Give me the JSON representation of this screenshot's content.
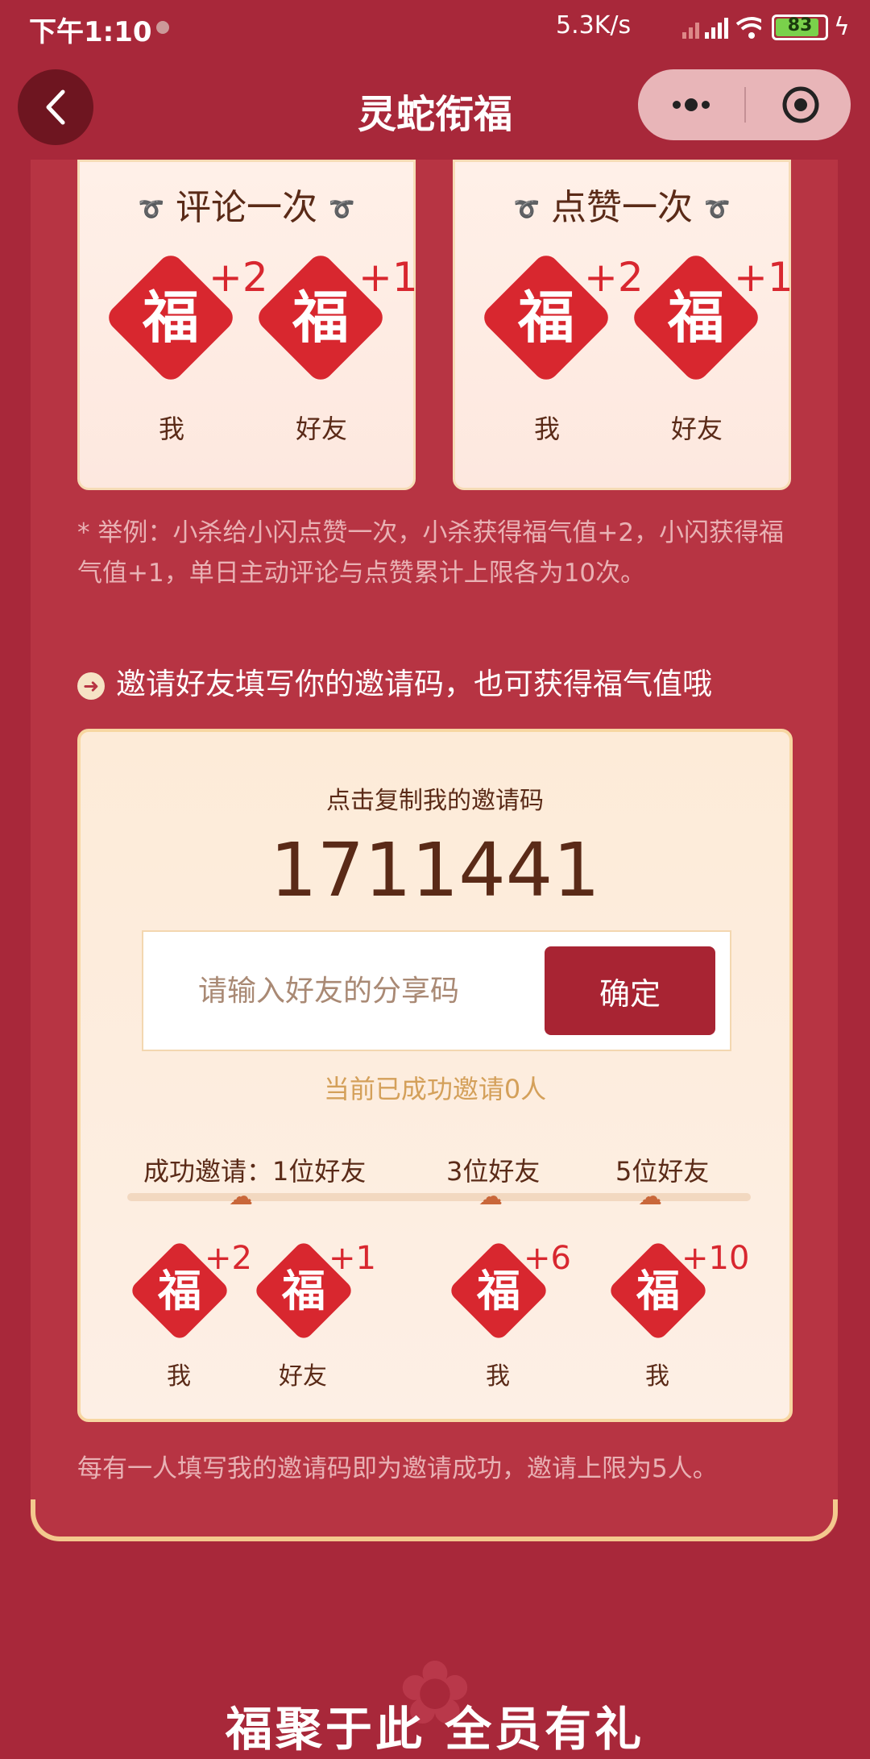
{
  "status_bar": {
    "time": "下午1:10",
    "net_speed": "5.3K/s",
    "battery": "83",
    "colors": {
      "battery_fill": "#7ad14b"
    }
  },
  "nav": {
    "title": "灵蛇衔福",
    "back_icon": "chevron-left-icon",
    "more_icon": "more-dots-icon",
    "close_icon": "target-icon"
  },
  "tasks": [
    {
      "title": "评论一次",
      "rewards": [
        {
          "value": "+2",
          "who": "我"
        },
        {
          "value": "+1",
          "who": "好友"
        }
      ]
    },
    {
      "title": "点赞一次",
      "rewards": [
        {
          "value": "+2",
          "who": "我"
        },
        {
          "value": "+1",
          "who": "好友"
        }
      ]
    }
  ],
  "fu_char": "福",
  "note": "* 举例：小杀给小闪点赞一次，小杀获得福气值+2，小闪获得福气值+1，单日主动评论与点赞累计上限各为10次。",
  "invite": {
    "heading": "邀请好友填写你的邀请码，也可获得福气值哦",
    "caption": "点击复制我的邀请码",
    "code": "1711441",
    "input_placeholder": "请输入好友的分享码",
    "confirm_label": "确定",
    "status": "当前已成功邀请0人",
    "tiers_prefix": "成功邀请：",
    "tiers": [
      {
        "label": "1位好友",
        "rewards": [
          {
            "value": "+2",
            "who": "我"
          },
          {
            "value": "+1",
            "who": "好友"
          }
        ]
      },
      {
        "label": "3位好友",
        "rewards": [
          {
            "value": "+6",
            "who": "我"
          }
        ]
      },
      {
        "label": "5位好友",
        "rewards": [
          {
            "value": "+10",
            "who": "我"
          }
        ]
      }
    ],
    "limit_note": "每有一人填写我的邀请码即为邀请成功，邀请上限为5人。"
  },
  "bottom_title": "福聚于此 全员有礼",
  "colors": {
    "background": "#a8283a",
    "accent": "#d8272f",
    "button": "#a82433",
    "status_text": "#d4a05a"
  }
}
